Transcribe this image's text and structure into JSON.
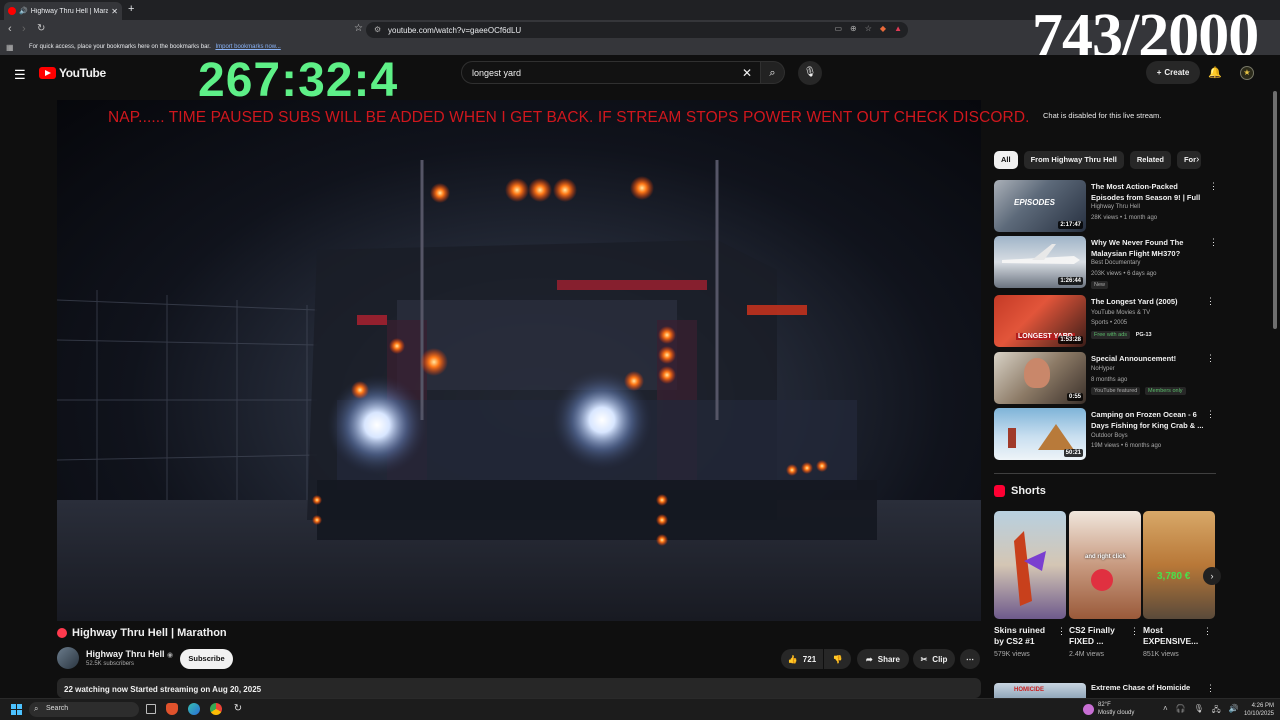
{
  "browser": {
    "tab_title": "Highway Thru Hell | Marathon",
    "url": "youtube.com/watch?v=gaeeOCf6dLU",
    "bookmarks_prompt": "For quick access, place your bookmarks here on the bookmarks bar.",
    "bookmarks_link": "Import bookmarks now..."
  },
  "overlay": {
    "counter": "743/2000",
    "timer": "267:32:4",
    "banner": "NAP......  TIME PAUSED SUBS WILL BE ADDED WHEN I GET BACK. IF STREAM STOPS POWER WENT OUT CHECK DISCORD.",
    "chat_note": "Chat is disabled for this live stream."
  },
  "youtube": {
    "logo_text": "YouTube",
    "search_value": "longest yard",
    "create_label": "Create"
  },
  "video": {
    "title": "Highway Thru Hell | Marathon",
    "channel": "Highway Thru Hell",
    "subscribers": "52.5K subscribers",
    "subscribe_label": "Subscribe",
    "likes": "721",
    "share_label": "Share",
    "clip_label": "Clip",
    "meta": "22 watching now  Started streaming on Aug 20, 2025"
  },
  "chips": [
    "All",
    "From Highway Thru Hell",
    "Related",
    "For"
  ],
  "recommendations": [
    {
      "title": "The Most Action-Packed Episodes from Season 9! | Full ...",
      "channel": "Highway Thru Hell",
      "meta": "28K views • 1 month ago",
      "duration": "2:17:47",
      "badge": "",
      "badge2": ""
    },
    {
      "title": "Why We Never Found The Malaysian Flight MH370?",
      "channel": "Best Documentary",
      "meta": "203K views • 6 days ago",
      "duration": "1:26:44",
      "badge": "New",
      "badge2": ""
    },
    {
      "title": "The Longest Yard (2005)",
      "channel": "YouTube Movies & TV",
      "meta": "Sports • 2005",
      "duration": "1:53:28",
      "badge": "Free with ads",
      "badge2": "PG-13"
    },
    {
      "title": "Special Announcement!",
      "channel": "NoHyper",
      "meta": "8 months ago",
      "duration": "0:55",
      "badge": "YouTube featured",
      "badge2": "Members only"
    },
    {
      "title": "Camping on Frozen Ocean - 6 Days Fishing for King Crab & ...",
      "channel": "Outdoor Boys",
      "meta": "19M views • 6 months ago",
      "duration": "50:21",
      "badge": "",
      "badge2": ""
    }
  ],
  "shorts": {
    "heading": "Shorts",
    "items": [
      {
        "title": "Skins ruined by CS2 #1",
        "views": "579K views",
        "overlay": ""
      },
      {
        "title": "CS2 Finally FIXED ...",
        "views": "2.4M views",
        "overlay": "and right click"
      },
      {
        "title": "Most EXPENSIVE...",
        "views": "851K views",
        "overlay": "3,780 €"
      }
    ]
  },
  "next_rec": {
    "title": "Extreme Chase of Homicide",
    "thumb_text": "HOMICIDE"
  },
  "taskbar": {
    "search_label": "Search",
    "temp": "82°F",
    "weather": "Mostly cloudy",
    "time": "4:26 PM",
    "date": "10/10/2025"
  },
  "colors": {
    "accent": "#ff0000",
    "timer": "#5ef087",
    "banner": "#d0171d"
  }
}
